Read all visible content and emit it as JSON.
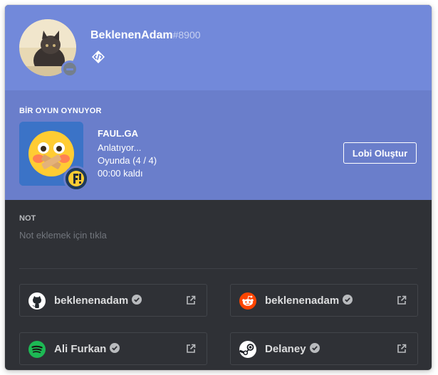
{
  "profile": {
    "username": "BeklenenAdam",
    "discriminator": "#8900",
    "status": "do-not-disturb",
    "badge_icon": "hypesquad-brilliance-icon"
  },
  "activity": {
    "header": "BİR OYUN OYNUYOR",
    "game_name": "FAUL.GA",
    "details": "Anlatıyor...",
    "state": "Oyunda (4 / 4)",
    "time": "00:00 kaldı",
    "button_label": "Lobi Oluştur"
  },
  "note": {
    "label": "NOT",
    "placeholder": "Not eklemek için tıkla"
  },
  "connected_accounts": [
    {
      "service": "github",
      "icon": "github-icon",
      "name": "beklenenadam",
      "verified": true
    },
    {
      "service": "reddit",
      "icon": "reddit-icon",
      "name": "beklenenadam",
      "verified": true
    },
    {
      "service": "spotify",
      "icon": "spotify-icon",
      "name": "Ali Furkan",
      "verified": true
    },
    {
      "service": "steam",
      "icon": "steam-icon",
      "name": "Delaney",
      "verified": true
    }
  ],
  "colors": {
    "header_bg": "#7289da",
    "activity_bg": "#6a7ecb",
    "body_bg": "#2f3136",
    "spotify": "#1db954",
    "reddit": "#ff4500"
  }
}
